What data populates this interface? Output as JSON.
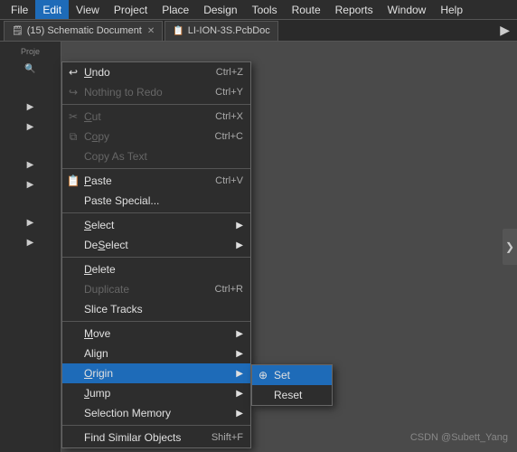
{
  "menubar": {
    "items": [
      {
        "label": "File",
        "id": "file"
      },
      {
        "label": "Edit",
        "id": "edit",
        "active": true
      },
      {
        "label": "View",
        "id": "view"
      },
      {
        "label": "Project",
        "id": "project"
      },
      {
        "label": "Place",
        "id": "place"
      },
      {
        "label": "Design",
        "id": "design"
      },
      {
        "label": "Tools",
        "id": "tools"
      },
      {
        "label": "Route",
        "id": "route"
      },
      {
        "label": "Reports",
        "id": "reports"
      },
      {
        "label": "Window",
        "id": "window"
      },
      {
        "label": "Help",
        "id": "help"
      }
    ]
  },
  "tabs": {
    "items": [
      {
        "label": "(15) Schematic Document",
        "icon": "📄",
        "id": "schematic"
      },
      {
        "label": "LI-ION-3S.PcbDoc",
        "icon": "📋",
        "id": "pcbdoc"
      }
    ],
    "arrow": "▶"
  },
  "edit_menu": {
    "items": [
      {
        "label": "Undo",
        "shortcut": "Ctrl+Z",
        "disabled": false,
        "has_icon": true
      },
      {
        "label": "Nothing to Redo",
        "shortcut": "Ctrl+Y",
        "disabled": true,
        "has_icon": true
      },
      {
        "separator": true
      },
      {
        "label": "Cut",
        "shortcut": "Ctrl+X",
        "disabled": true,
        "has_icon": true
      },
      {
        "label": "Copy",
        "shortcut": "Ctrl+C",
        "disabled": true,
        "has_icon": true
      },
      {
        "label": "Copy As Text",
        "shortcut": "",
        "disabled": true,
        "has_icon": false
      },
      {
        "separator": true
      },
      {
        "label": "Paste",
        "shortcut": "Ctrl+V",
        "disabled": false,
        "has_icon": true
      },
      {
        "label": "Paste Special...",
        "shortcut": "",
        "disabled": false,
        "has_icon": false
      },
      {
        "separator": true
      },
      {
        "label": "Select",
        "shortcut": "",
        "disabled": false,
        "has_submenu": true
      },
      {
        "label": "DeSelect",
        "shortcut": "",
        "disabled": false,
        "has_submenu": true
      },
      {
        "separator": true
      },
      {
        "label": "Delete",
        "shortcut": "",
        "disabled": false
      },
      {
        "label": "Duplicate",
        "shortcut": "Ctrl+R",
        "disabled": true
      },
      {
        "label": "Slice Tracks",
        "shortcut": "",
        "disabled": false
      },
      {
        "separator": true
      },
      {
        "label": "Move",
        "shortcut": "",
        "disabled": false,
        "has_submenu": true
      },
      {
        "label": "Align",
        "shortcut": "",
        "disabled": false,
        "has_submenu": true
      },
      {
        "label": "Origin",
        "shortcut": "",
        "disabled": false,
        "has_submenu": true,
        "highlighted": true
      },
      {
        "label": "Jump",
        "shortcut": "",
        "disabled": false,
        "has_submenu": true
      },
      {
        "label": "Selection Memory",
        "shortcut": "",
        "disabled": false,
        "has_submenu": true
      },
      {
        "separator": true
      },
      {
        "label": "Find Similar Objects",
        "shortcut": "Shift+F",
        "disabled": false
      }
    ]
  },
  "origin_submenu": {
    "items": [
      {
        "label": "Set",
        "highlighted": true,
        "has_icon": true
      },
      {
        "label": "Reset",
        "has_icon": false
      }
    ]
  },
  "watermark": {
    "text": "CSDN @Subett_Yang"
  },
  "side_arrow": "❯",
  "project_panel": {
    "label": "Proje"
  }
}
